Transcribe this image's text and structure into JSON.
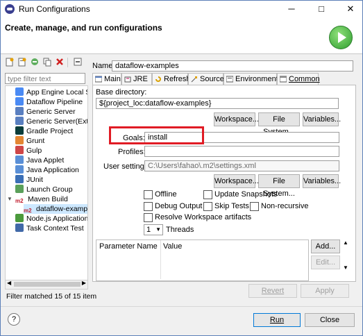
{
  "window": {
    "title": "Run Configurations",
    "minimize": "─",
    "maximize": "□",
    "close": "✕"
  },
  "header": {
    "title": "Create, manage, and run configurations"
  },
  "left": {
    "filter_placeholder": "type filter text",
    "tree": [
      {
        "label": "App Engine Local Se",
        "icon": "app-engine-icon"
      },
      {
        "label": "Dataflow Pipeline",
        "icon": "dataflow-icon"
      },
      {
        "label": "Generic Server",
        "icon": "server-icon"
      },
      {
        "label": "Generic Server(Extern",
        "icon": "server-icon"
      },
      {
        "label": "Gradle Project",
        "icon": "gradle-icon"
      },
      {
        "label": "Grunt",
        "icon": "grunt-icon"
      },
      {
        "label": "Gulp",
        "icon": "gulp-icon"
      },
      {
        "label": "Java Applet",
        "icon": "java-icon"
      },
      {
        "label": "Java Application",
        "icon": "java-icon"
      },
      {
        "label": "JUnit",
        "icon": "junit-icon"
      },
      {
        "label": "Launch Group",
        "icon": "launch-group-icon"
      },
      {
        "label": "Maven Build",
        "icon": "maven-icon",
        "prefix": "m2"
      },
      {
        "label": "dataflow-example",
        "icon": "maven-icon",
        "prefix": "m2",
        "child": true
      },
      {
        "label": "Node.js Application",
        "icon": "nodejs-icon"
      },
      {
        "label": "Task Context Test",
        "icon": "task-icon"
      }
    ],
    "status": "Filter matched 15 of 15 item"
  },
  "form": {
    "name_label": "Name:",
    "name_value": "dataflow-examples",
    "tabs": [
      {
        "label": "Main"
      },
      {
        "label": "JRE"
      },
      {
        "label": "Refresh"
      },
      {
        "label": "Source"
      },
      {
        "label": "Environment"
      },
      {
        "label": "Common"
      }
    ],
    "basedir_label": "Base directory:",
    "basedir_value": "${project_loc:dataflow-examples}",
    "workspace_btn": "Workspace...",
    "filesystem_btn": "File System...",
    "variables_btn": "Variables...",
    "goals_label": "Goals:",
    "goals_value": "install",
    "profiles_label": "Profiles:",
    "profiles_value": "",
    "usersettings_label": "User settings:",
    "usersettings_value": "C:\\Users\\fahao\\.m2\\settings.xml",
    "offline": "Offline",
    "update_snapshots": "Update Snapshots",
    "debug_output": "Debug Output",
    "skip_tests": "Skip Tests",
    "non_recursive": "Non-recursive",
    "resolve_workspace": "Resolve Workspace artifacts",
    "threads_value": "1",
    "threads_label": "Threads",
    "param_col": "Parameter Name",
    "value_col": "Value",
    "add_btn": "Add...",
    "edit_btn": "Edit...",
    "revert_btn": "Revert",
    "apply_btn": "Apply"
  },
  "footer": {
    "help": "?",
    "run_btn": "Run",
    "close_btn": "Close"
  }
}
